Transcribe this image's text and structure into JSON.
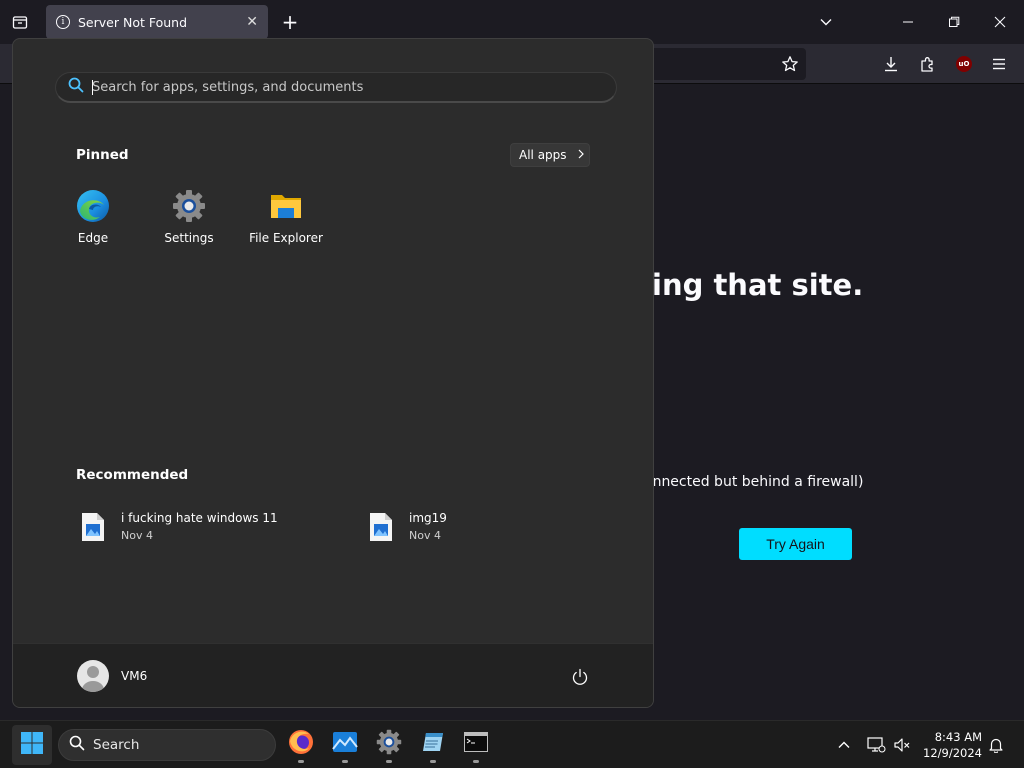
{
  "browser": {
    "tab_title": "Server Not Found",
    "error_headline": "ing that site.",
    "error_item": "onnected but behind a firewall)",
    "try_again_label": "Try Again"
  },
  "start_menu": {
    "search_placeholder": "Search for apps, settings, and documents",
    "pinned_title": "Pinned",
    "all_apps_label": "All apps",
    "pinned_apps": [
      {
        "label": "Edge",
        "icon": "edge-icon"
      },
      {
        "label": "Settings",
        "icon": "settings-gear-icon"
      },
      {
        "label": "File Explorer",
        "icon": "folder-icon"
      }
    ],
    "recommended_title": "Recommended",
    "recommended": [
      {
        "name": "i fucking hate windows 11",
        "date": "Nov 4",
        "icon": "image-file-icon"
      },
      {
        "name": "img19",
        "date": "Nov 4",
        "icon": "image-file-icon"
      }
    ],
    "user_name": "VM6"
  },
  "taskbar": {
    "search_label": "Search",
    "apps": [
      "firefox-icon",
      "photos-icon",
      "settings-gear-icon",
      "notepad-icon",
      "terminal-icon"
    ],
    "time": "8:43 AM",
    "date": "12/9/2024"
  },
  "colors": {
    "accent_cyan": "#00ddff",
    "start_bg": "#2c2c2c",
    "windows_blue": "#0078d4"
  }
}
